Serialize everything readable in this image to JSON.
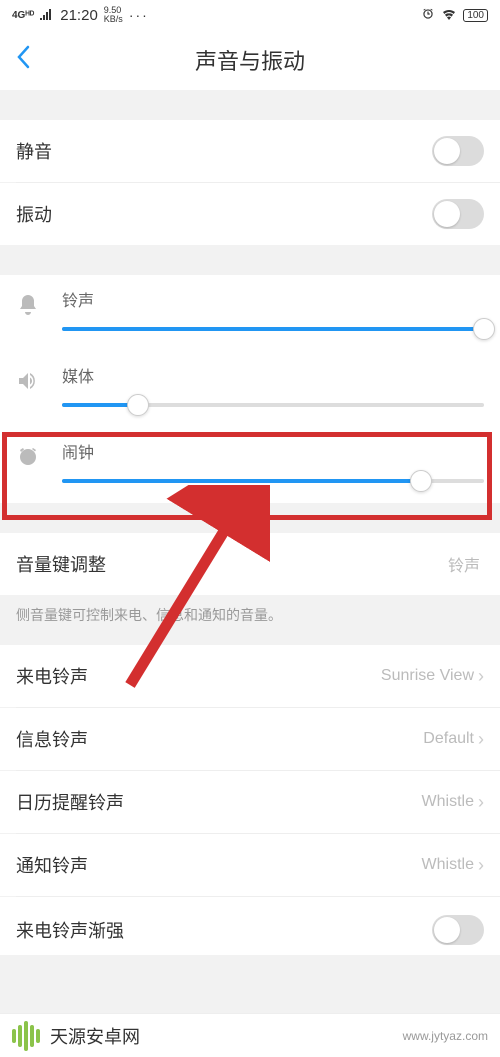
{
  "status": {
    "network": "4Gᴴᴰ",
    "time": "21:20",
    "speed_top": "9.50",
    "speed_bot": "KB/s",
    "dots": "···",
    "battery": "100"
  },
  "header": {
    "title": "声音与振动"
  },
  "toggles": {
    "mute_label": "静音",
    "vibrate_label": "振动"
  },
  "sliders": {
    "ringtone": {
      "label": "铃声",
      "value": 100
    },
    "media": {
      "label": "媒体",
      "value": 18
    },
    "alarm": {
      "label": "闹钟",
      "value": 85
    }
  },
  "volume_key": {
    "label": "音量键调整",
    "value": "铃声",
    "description": "侧音量键可控制来电、信息和通知的音量。"
  },
  "ringtones": {
    "incoming": {
      "label": "来电铃声",
      "value": "Sunrise View"
    },
    "message": {
      "label": "信息铃声",
      "value": "Default"
    },
    "calendar": {
      "label": "日历提醒铃声",
      "value": "Whistle"
    },
    "notification": {
      "label": "通知铃声",
      "value": "Whistle"
    },
    "crescendo": {
      "label": "来电铃声渐强"
    }
  },
  "watermark": {
    "text": "天源安卓网",
    "url": "www.jytyaz.com"
  }
}
